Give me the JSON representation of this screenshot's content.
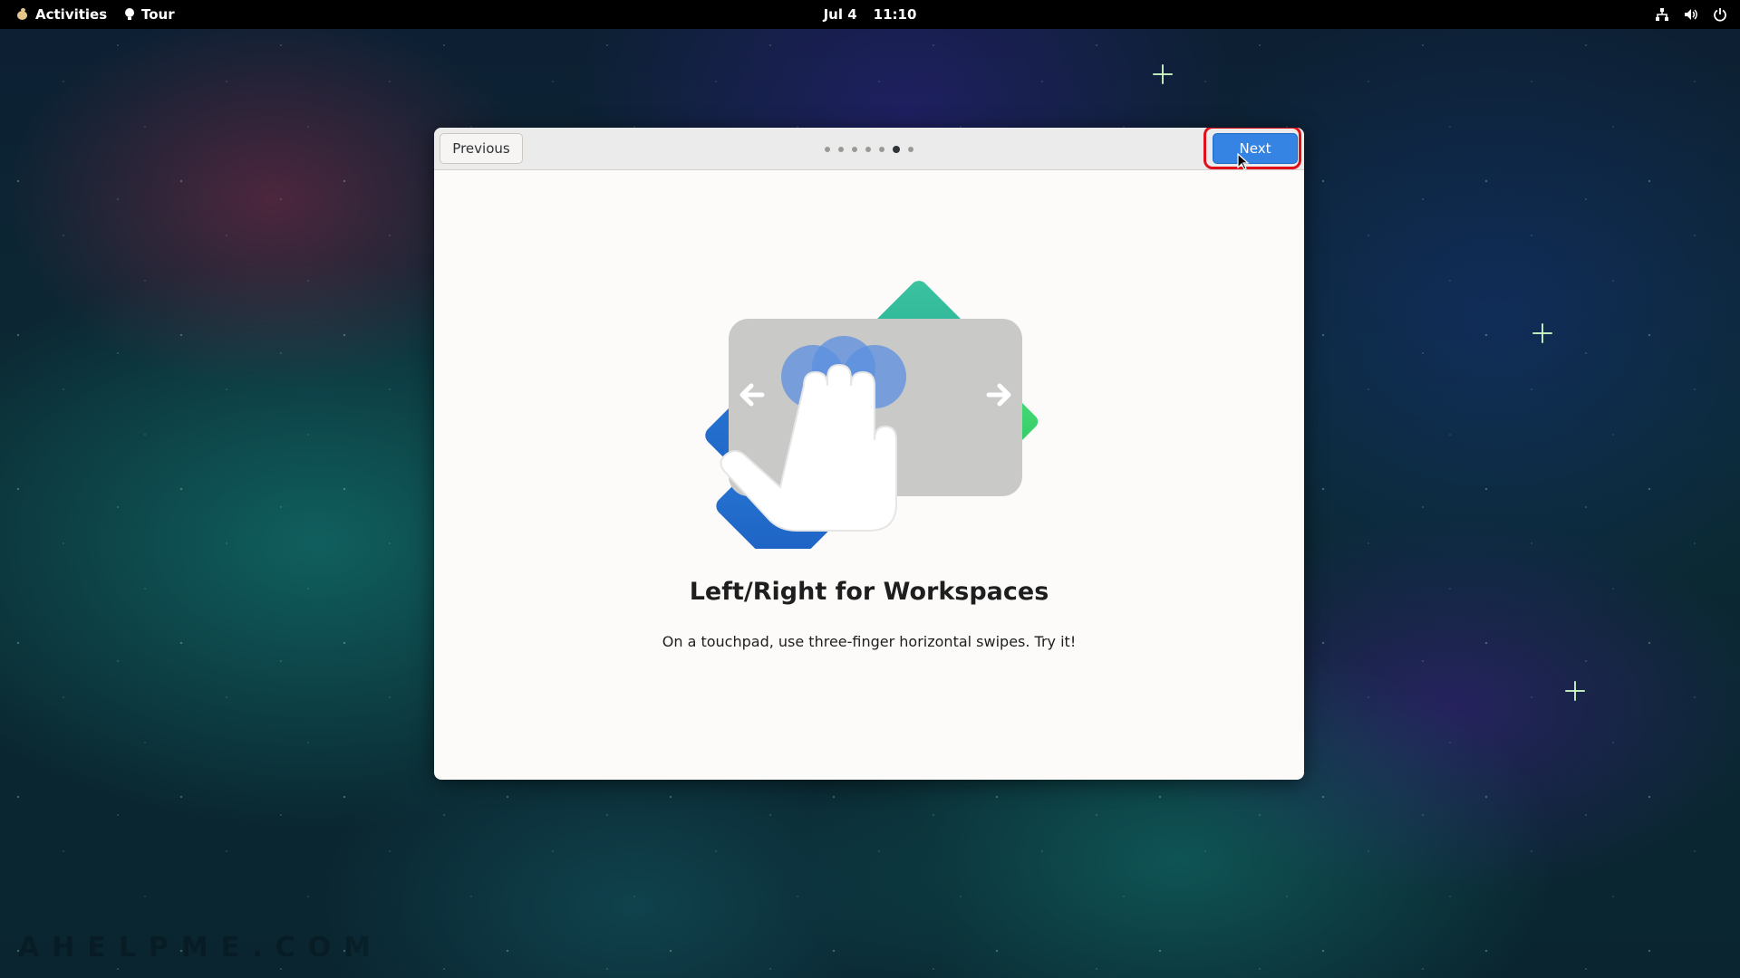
{
  "topbar": {
    "activities_label": "Activities",
    "app_label": "Tour",
    "date": "Jul 4",
    "time": "11:10",
    "tray_icons": [
      "network-icon",
      "volume-icon",
      "power-icon"
    ]
  },
  "dialog": {
    "previous_label": "Previous",
    "next_label": "Next",
    "page_count": 7,
    "current_page": 6,
    "title": "Left/Right for Workspaces",
    "description": "On a touchpad, use three-finger horizontal swipes. Try it!",
    "accent_color": "#3584e4",
    "highlight_color": "#e0101a"
  },
  "wallpaper": {
    "watermark": "AHELPME.COM"
  }
}
